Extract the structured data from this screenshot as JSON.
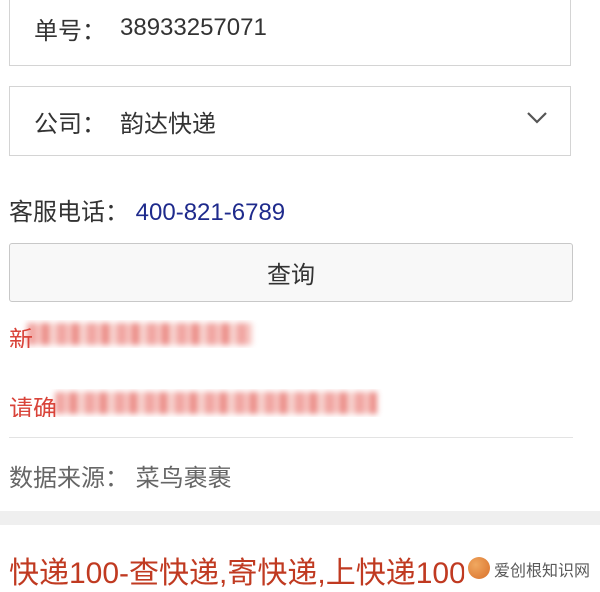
{
  "form": {
    "tracking_label": "单号：",
    "tracking_value": "38933257071",
    "company_label": "公司：",
    "company_value": "韵达快递"
  },
  "service": {
    "label": "客服电话：",
    "phone": "400-821-6789"
  },
  "query_button": "查询",
  "messages": {
    "msg1_prefix": "新",
    "msg2_prefix": "请确"
  },
  "source": {
    "label": "数据来源：",
    "value": "菜鸟裹裹"
  },
  "banner": {
    "text": "快递100-查快递,寄快递,上快递100"
  },
  "watermark": {
    "text": "爱创根知识网"
  },
  "colors": {
    "phone": "#1e2a8c",
    "message_red": "#d9443a",
    "banner_red": "#c03a21"
  }
}
